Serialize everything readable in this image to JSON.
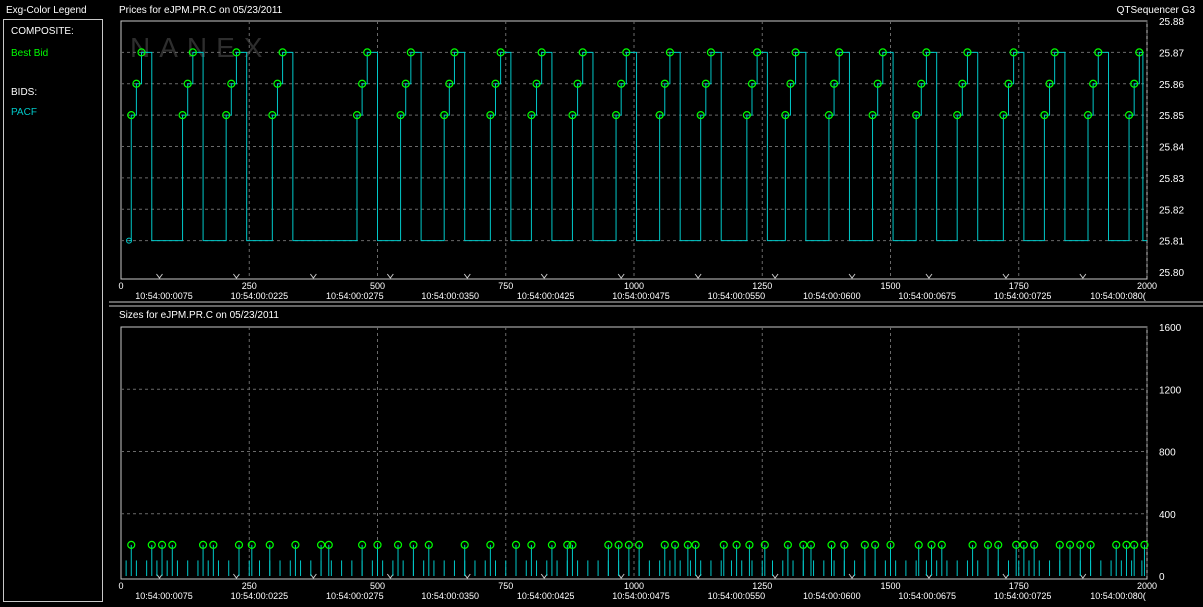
{
  "legend": {
    "title": "Exg-Color Legend",
    "composite_heading": "COMPOSITE:",
    "composite_item": "Best Bid",
    "bids_heading": "BIDS:",
    "bids_item": "PACF"
  },
  "app_name": "QTSequencer G3",
  "watermark": "NANEX",
  "colors": {
    "best_bid": "#00ff00",
    "pacf": "#00c8c8",
    "grid": "#6a6a6a",
    "axis": "#c8c8c8"
  },
  "chart_data": [
    {
      "type": "line",
      "title": "Prices for  eJPM.PR.C  on  05/23/2011",
      "x_ticks": [
        0,
        250,
        500,
        750,
        1000,
        1250,
        1500,
        1750,
        2000
      ],
      "time_labels": [
        "10:54:00:0075",
        "10:54:00:0225",
        "10:54:00:0275",
        "10:54:00:0350",
        "10:54:00:0425",
        "10:54:00:0475",
        "10:54:00:0550",
        "10:54:00:0600",
        "10:54:00:0675",
        "10:54:00:0725",
        "10:54:00:080("
      ],
      "y_ticks": [
        25.8,
        25.81,
        25.82,
        25.83,
        25.84,
        25.85,
        25.86,
        25.87,
        25.88
      ],
      "ylim": [
        25.8,
        25.88
      ],
      "xlim": [
        0,
        2000
      ],
      "grid": true,
      "cycle_starts": [
        20,
        120,
        205,
        295,
        460,
        545,
        630,
        720,
        800,
        880,
        965,
        1050,
        1130,
        1220,
        1295,
        1380,
        1465,
        1550,
        1630,
        1720,
        1800,
        1885,
        1965
      ],
      "cycle_prices": [
        25.85,
        25.86,
        25.87
      ],
      "low_price": 25.81,
      "series": [
        {
          "name": "Best Bid",
          "marker": "circle"
        },
        {
          "name": "PACF"
        }
      ]
    },
    {
      "type": "bar",
      "title": "Sizes for  eJPM.PR.C  on  05/23/2011",
      "x_ticks": [
        0,
        250,
        500,
        750,
        1000,
        1250,
        1500,
        1750,
        2000
      ],
      "time_labels": [
        "10:54:00:0075",
        "10:54:00:0225",
        "10:54:00:0275",
        "10:54:00:0350",
        "10:54:00:0425",
        "10:54:00:0475",
        "10:54:00:0550",
        "10:54:00:0600",
        "10:54:00:0675",
        "10:54:00:0725",
        "10:54:00:080("
      ],
      "y_ticks": [
        0,
        400,
        800,
        1200,
        1600
      ],
      "ylim": [
        0,
        1600
      ],
      "xlim": [
        0,
        2000
      ],
      "grid": true,
      "best_bid_size": 200,
      "best_bid_x": [
        20,
        60,
        80,
        100,
        160,
        180,
        230,
        255,
        290,
        340,
        390,
        405,
        470,
        500,
        540,
        570,
        600,
        670,
        720,
        770,
        800,
        840,
        870,
        880,
        950,
        970,
        990,
        1010,
        1060,
        1080,
        1105,
        1120,
        1175,
        1200,
        1225,
        1255,
        1300,
        1330,
        1345,
        1385,
        1410,
        1450,
        1470,
        1500,
        1555,
        1580,
        1600,
        1660,
        1690,
        1710,
        1745,
        1760,
        1780,
        1830,
        1850,
        1870,
        1890,
        1940,
        1960,
        1975,
        1995
      ],
      "pacf_size": 100,
      "pacf_step": 20
    }
  ]
}
